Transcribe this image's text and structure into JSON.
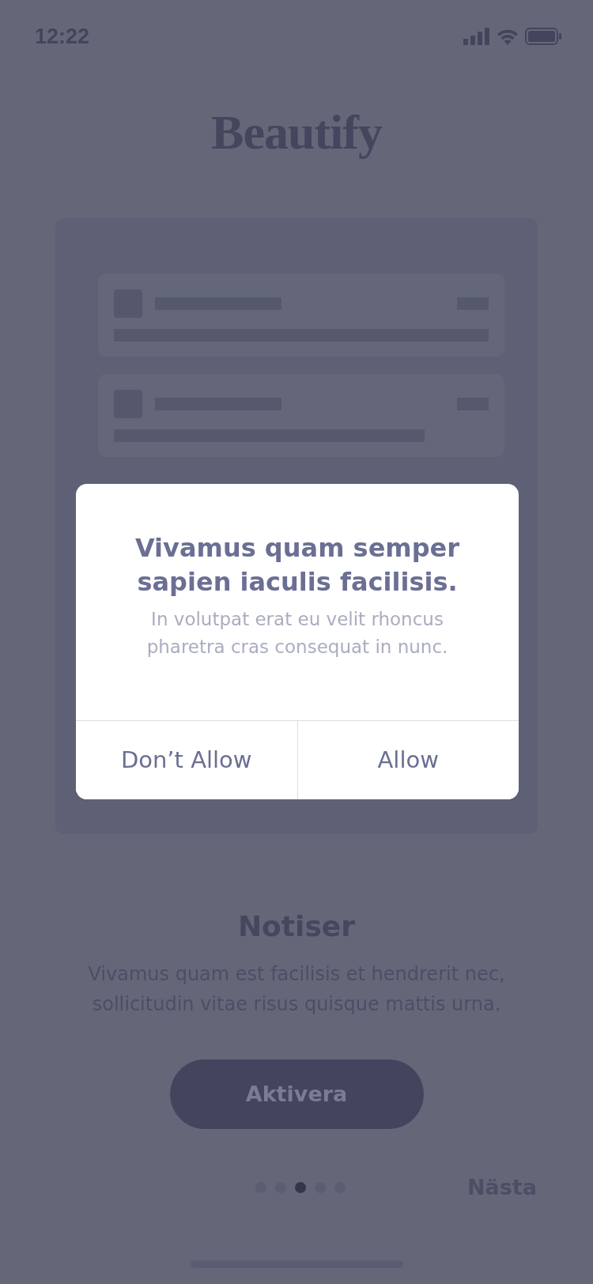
{
  "status_bar": {
    "time": "12:22"
  },
  "app_title": "Beautify",
  "illustration": {
    "rows": [
      {
        "kind": "short"
      },
      {
        "kind": "shorter"
      }
    ]
  },
  "heading": "Notiser",
  "description": "Vivamus quam est facilisis et hendrerit nec, sollicitudin vitae risus quisque mattis urna.",
  "primary_button": "Aktivera",
  "pager": [
    {
      "selected": false
    },
    {
      "selected": false
    },
    {
      "selected": true
    },
    {
      "selected": false
    },
    {
      "selected": false
    }
  ],
  "next_link": "Nästa",
  "dialog": {
    "title": "Vivamus quam semper sapien iaculis facilisis.",
    "message": "In volutpat erat eu velit rhoncus pharetra cras consequat in nunc.",
    "buttons": [
      "Don’t Allow",
      "Allow"
    ]
  }
}
